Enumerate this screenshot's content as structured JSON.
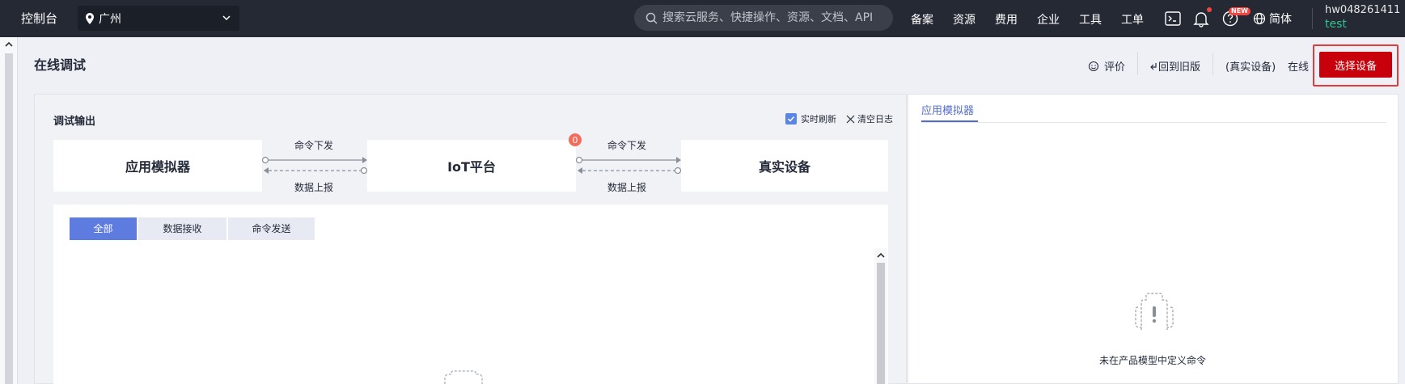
{
  "topbar": {
    "console": "控制台",
    "region": "广州",
    "search_placeholder": "搜索云服务、快捷操作、资源、文档、API",
    "nav": [
      "备案",
      "资源",
      "费用",
      "企业",
      "工具",
      "工单"
    ],
    "new_badge": "NEW",
    "lang": "简体",
    "username": "hw048261411",
    "subuser": "test"
  },
  "header": {
    "title": "在线调试",
    "rate": "评价",
    "back_old": "回到旧版",
    "device_type": "(真实设备)",
    "status": "在线",
    "select_device": "选择设备"
  },
  "debug": {
    "title": "调试输出",
    "realtime_refresh": "实时刷新",
    "clear_log": "清空日志",
    "flow": {
      "simulator": "应用模拟器",
      "iot": "IoT平台",
      "device": "真实设备",
      "cmd_down": "命令下发",
      "data_up": "数据上报",
      "badge_count": "0"
    },
    "tabs": [
      "全部",
      "数据接收",
      "命令发送"
    ]
  },
  "simulator_panel": {
    "tab": "应用模拟器",
    "empty_text": "未在产品模型中定义命令"
  },
  "colors": {
    "topbar_bg": "#242933",
    "primary_red": "#c7000b",
    "accent_blue": "#5e7ce0",
    "online_green": "#31c48d"
  }
}
